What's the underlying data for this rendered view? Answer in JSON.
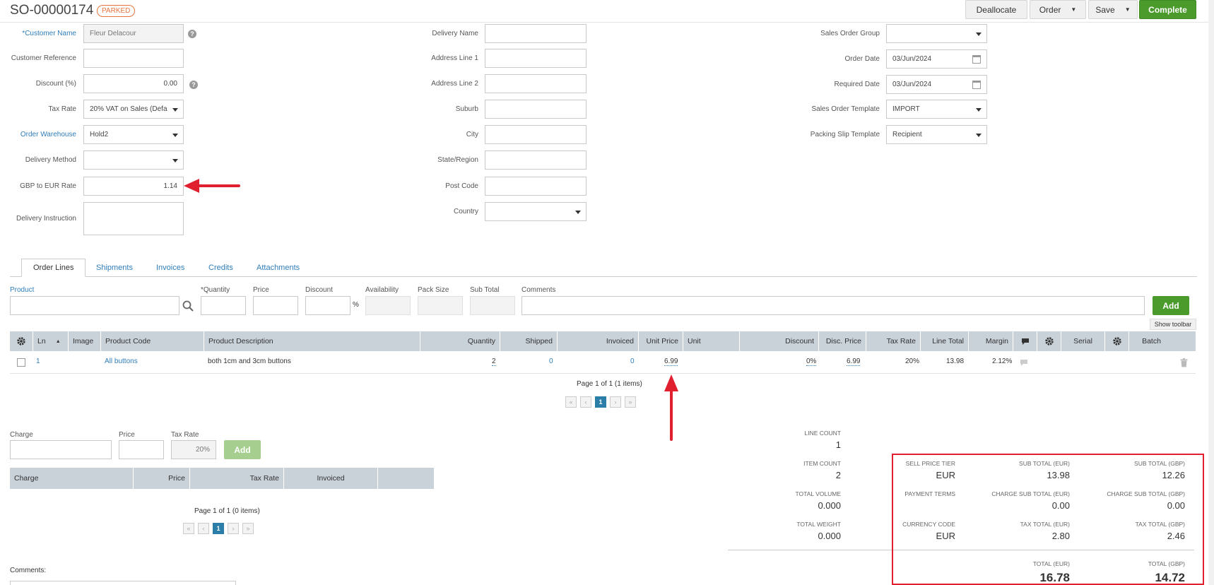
{
  "header": {
    "order_number": "SO-00000174",
    "status": "PARKED",
    "buttons": {
      "deallocate": "Deallocate",
      "order": "Order",
      "save": "Save",
      "complete": "Complete"
    }
  },
  "form_left": {
    "customer_name_label": "*Customer Name",
    "customer_name": "Fleur Delacour",
    "customer_reference_label": "Customer Reference",
    "discount_label": "Discount (%)",
    "discount": "0.00",
    "tax_rate_label": "Tax Rate",
    "tax_rate": "20% VAT on Sales (Defa",
    "order_warehouse_label": "Order Warehouse",
    "order_warehouse": "Hold2",
    "delivery_method_label": "Delivery Method",
    "gbp_eur_label": "GBP to EUR Rate",
    "gbp_eur": "1.14",
    "delivery_instruction_label": "Delivery Instruction"
  },
  "form_mid": {
    "delivery_name_label": "Delivery Name",
    "address1_label": "Address Line 1",
    "address2_label": "Address Line 2",
    "suburb_label": "Suburb",
    "city_label": "City",
    "state_label": "State/Region",
    "postcode_label": "Post Code",
    "country_label": "Country"
  },
  "form_right": {
    "so_group_label": "Sales Order Group",
    "order_date_label": "Order Date",
    "order_date": "03/Jun/2024",
    "required_date_label": "Required Date",
    "required_date": "03/Jun/2024",
    "template_label": "Sales Order Template",
    "template": "IMPORT",
    "packing_label": "Packing Slip Template",
    "packing": "Recipient"
  },
  "tabs": [
    "Order Lines",
    "Shipments",
    "Invoices",
    "Credits",
    "Attachments"
  ],
  "order_line_entry": {
    "product": "Product",
    "quantity": "*Quantity",
    "price": "Price",
    "discount": "Discount",
    "pct": "%",
    "availability": "Availability",
    "pack_size": "Pack Size",
    "sub_total": "Sub Total",
    "comments": "Comments",
    "add": "Add",
    "show_toolbar": "Show toolbar"
  },
  "grid": {
    "headers": [
      "Ln",
      "Image",
      "Product Code",
      "Product Description",
      "Quantity",
      "Shipped",
      "Invoiced",
      "Unit Price",
      "Unit",
      "Discount",
      "Disc. Price",
      "Tax Rate",
      "Line Total",
      "Margin",
      "Serial",
      "Batch"
    ],
    "row": {
      "ln": "1",
      "code": "All buttons",
      "desc": "both 1cm and 3cm buttons",
      "quantity": "2",
      "shipped": "0",
      "invoiced": "0",
      "unit_price": "6.99",
      "discount": "0%",
      "disc_price": "6.99",
      "tax_rate": "20%",
      "line_total": "13.98",
      "margin": "2.12%"
    },
    "pager_text": "Page 1 of 1 (1 items)",
    "page": "1"
  },
  "charges": {
    "charge_label": "Charge",
    "price_label": "Price",
    "tax_label": "Tax Rate",
    "tax_value": "20%",
    "add": "Add",
    "headers": [
      "Charge",
      "Price",
      "Tax Rate",
      "Invoiced"
    ],
    "pager_text": "Page 1 of 1 (0 items)",
    "page": "1"
  },
  "comments_label": "Comments:",
  "summary": {
    "line_count_label": "LINE COUNT",
    "line_count": "1",
    "item_count_label": "ITEM COUNT",
    "item_count": "2",
    "total_volume_label": "TOTAL VOLUME",
    "total_volume": "0.000",
    "total_weight_label": "TOTAL WEIGHT",
    "total_weight": "0.000",
    "sell_tier_label": "SELL PRICE TIER",
    "sell_tier": "EUR",
    "payment_terms_label": "PAYMENT TERMS",
    "currency_code_label": "CURRENCY CODE",
    "currency_code": "EUR",
    "subtotal_eur_label": "SUB TOTAL (EUR)",
    "subtotal_eur": "13.98",
    "subtotal_gbp_label": "SUB TOTAL (GBP)",
    "subtotal_gbp": "12.26",
    "charge_eur_label": "CHARGE SUB TOTAL (EUR)",
    "charge_eur": "0.00",
    "charge_gbp_label": "CHARGE SUB TOTAL (GBP)",
    "charge_gbp": "0.00",
    "tax_eur_label": "TAX TOTAL (EUR)",
    "tax_eur": "2.80",
    "tax_gbp_label": "TAX TOTAL (GBP)",
    "tax_gbp": "2.46",
    "total_eur_label": "TOTAL (EUR)",
    "total_eur": "16.78",
    "total_gbp_label": "TOTAL (GBP)",
    "total_gbp": "14.72"
  },
  "colors": {
    "accent": "#2f7db8",
    "green": "#4a9a2c",
    "status": "#e8743b",
    "annotation": "#e0202f"
  }
}
